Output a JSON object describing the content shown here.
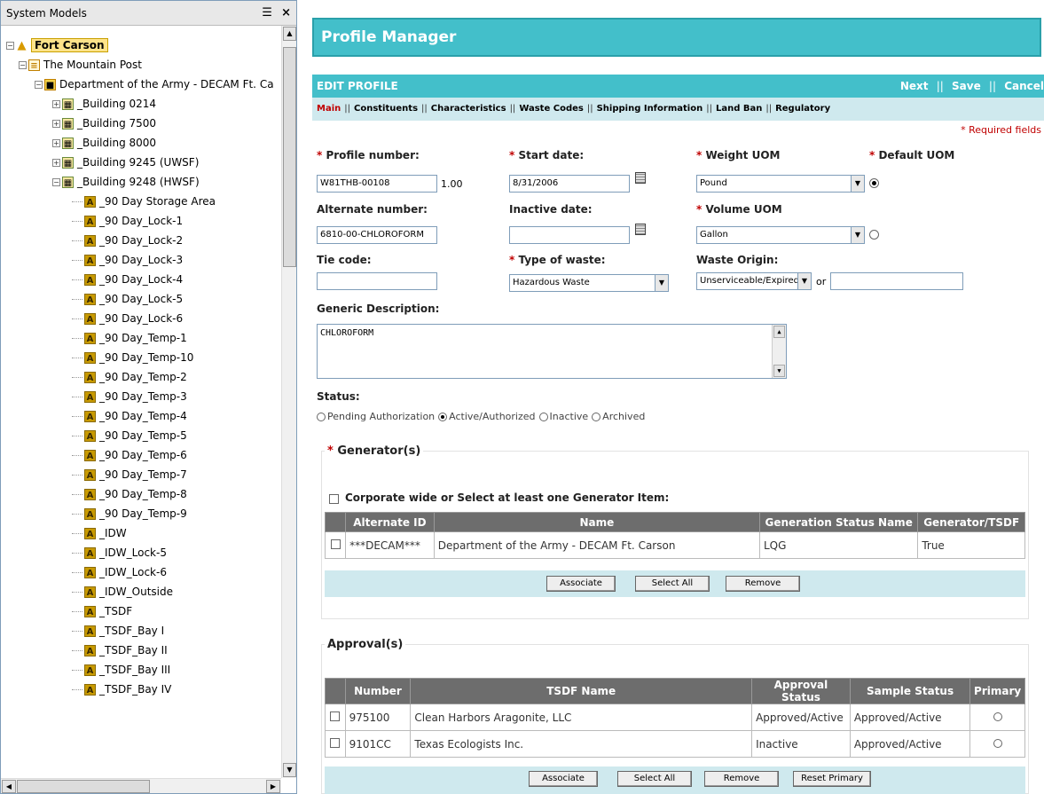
{
  "tree": {
    "header": "System Models",
    "icons": {
      "list": "list-icon",
      "close": "close-icon"
    },
    "nodes": [
      {
        "label": "Fort Carson",
        "level": 0,
        "icon": "home-icon",
        "selected": true
      },
      {
        "label": "The Mountain Post",
        "level": 1,
        "icon": "post-icon"
      },
      {
        "label": "Department of the Army - DECAM Ft. Ca",
        "level": 2,
        "icon": "department-icon"
      },
      {
        "label": "_Building 0214",
        "level": 3,
        "icon": "building-icon"
      },
      {
        "label": "_Building 7500",
        "level": 3,
        "icon": "building-icon"
      },
      {
        "label": "_Building 8000",
        "level": 3,
        "icon": "building-icon"
      },
      {
        "label": "_Building 9245 (UWSF)",
        "level": 3,
        "icon": "building-icon"
      },
      {
        "label": "_Building 9248 (HWSF)",
        "level": 3,
        "icon": "building-icon"
      },
      {
        "label": "_90 Day Storage Area",
        "level": 4,
        "icon": "area-icon"
      },
      {
        "label": "_90 Day_Lock-1",
        "level": 4,
        "icon": "area-icon"
      },
      {
        "label": "_90 Day_Lock-2",
        "level": 4,
        "icon": "area-icon"
      },
      {
        "label": "_90 Day_Lock-3",
        "level": 4,
        "icon": "area-icon"
      },
      {
        "label": "_90 Day_Lock-4",
        "level": 4,
        "icon": "area-icon"
      },
      {
        "label": "_90 Day_Lock-5",
        "level": 4,
        "icon": "area-icon"
      },
      {
        "label": "_90 Day_Lock-6",
        "level": 4,
        "icon": "area-icon"
      },
      {
        "label": "_90 Day_Temp-1",
        "level": 4,
        "icon": "area-icon"
      },
      {
        "label": "_90 Day_Temp-10",
        "level": 4,
        "icon": "area-icon"
      },
      {
        "label": "_90 Day_Temp-2",
        "level": 4,
        "icon": "area-icon"
      },
      {
        "label": "_90 Day_Temp-3",
        "level": 4,
        "icon": "area-icon"
      },
      {
        "label": "_90 Day_Temp-4",
        "level": 4,
        "icon": "area-icon"
      },
      {
        "label": "_90 Day_Temp-5",
        "level": 4,
        "icon": "area-icon"
      },
      {
        "label": "_90 Day_Temp-6",
        "level": 4,
        "icon": "area-icon"
      },
      {
        "label": "_90 Day_Temp-7",
        "level": 4,
        "icon": "area-icon"
      },
      {
        "label": "_90 Day_Temp-8",
        "level": 4,
        "icon": "area-icon"
      },
      {
        "label": "_90 Day_Temp-9",
        "level": 4,
        "icon": "area-icon"
      },
      {
        "label": "_IDW",
        "level": 4,
        "icon": "area-icon"
      },
      {
        "label": "_IDW_Lock-5",
        "level": 4,
        "icon": "area-icon"
      },
      {
        "label": "_IDW_Lock-6",
        "level": 4,
        "icon": "area-icon"
      },
      {
        "label": "_IDW_Outside",
        "level": 4,
        "icon": "area-icon"
      },
      {
        "label": "_TSDF",
        "level": 4,
        "icon": "area-icon"
      },
      {
        "label": "_TSDF_Bay I",
        "level": 4,
        "icon": "area-icon"
      },
      {
        "label": "_TSDF_Bay II",
        "level": 4,
        "icon": "area-icon"
      },
      {
        "label": "_TSDF_Bay III",
        "level": 4,
        "icon": "area-icon"
      },
      {
        "label": "_TSDF_Bay IV",
        "level": 4,
        "icon": "area-icon"
      }
    ]
  },
  "main": {
    "title": "Profile Manager",
    "edit_header": "EDIT PROFILE",
    "actions": {
      "next": "Next",
      "save": "Save",
      "cancel": "Cancel",
      "sep": "||"
    },
    "tabs": [
      {
        "label": "Main",
        "active": true
      },
      {
        "label": "Constituents"
      },
      {
        "label": "Characteristics"
      },
      {
        "label": "Waste Codes"
      },
      {
        "label": "Shipping Information"
      },
      {
        "label": "Land Ban"
      },
      {
        "label": "Regulatory"
      }
    ],
    "tab_sep": "||",
    "required_note": "* Required fields"
  },
  "form": {
    "profile_number": {
      "label": "Profile number:",
      "value": "W81THB-00108",
      "version": "1.00"
    },
    "start_date": {
      "label": "Start date:",
      "value": "8/31/2006"
    },
    "weight_uom": {
      "label": "Weight UOM",
      "value": "Pound"
    },
    "default_uom": {
      "label": "Default UOM",
      "weight_selected": true
    },
    "alternate_number": {
      "label": "Alternate number:",
      "value": "6810-00-CHLOROFORM"
    },
    "inactive_date": {
      "label": "Inactive date:",
      "value": ""
    },
    "volume_uom": {
      "label": "Volume UOM",
      "value": "Gallon"
    },
    "tie_code": {
      "label": "Tie code:",
      "value": ""
    },
    "type_of_waste": {
      "label": "Type of waste:",
      "value": "Hazardous Waste"
    },
    "waste_origin": {
      "label": "Waste Origin:",
      "value": "Unserviceable/Expired",
      "or": "or",
      "other": ""
    },
    "generic_description": {
      "label": "Generic Description:",
      "value": "CHLOROFORM"
    },
    "status": {
      "label": "Status:",
      "options": [
        "Pending Authorization",
        "Active/Authorized",
        "Inactive",
        "Archived"
      ],
      "selected": "Active/Authorized"
    },
    "star": "*"
  },
  "generators": {
    "legend": "Generator(s)",
    "corporate_label": "Corporate wide or Select at least one Generator Item:",
    "columns": [
      "Alternate ID",
      "Name",
      "Generation Status Name",
      "Generator/TSDF"
    ],
    "rows": [
      {
        "alt_id": "***DECAM***",
        "name": "Department of the Army - DECAM Ft. Carson",
        "status": "LQG",
        "gen_tsdf": "True"
      }
    ],
    "buttons": {
      "associate": "Associate",
      "select_all": "Select All",
      "remove": "Remove"
    }
  },
  "approvals": {
    "legend": "Approval(s)",
    "columns": [
      "Number",
      "TSDF Name",
      "Approval Status",
      "Sample Status",
      "Primary"
    ],
    "rows": [
      {
        "number": "975100",
        "tsdf": "Clean Harbors Aragonite, LLC",
        "approval": "Approved/Active",
        "sample": "Approved/Active"
      },
      {
        "number": "9101CC",
        "tsdf": "Texas Ecologists Inc.",
        "approval": "Inactive",
        "sample": "Approved/Active"
      }
    ],
    "buttons": {
      "associate": "Associate",
      "select_all": "Select All",
      "remove": "Remove",
      "reset_primary": "Reset Primary"
    }
  }
}
